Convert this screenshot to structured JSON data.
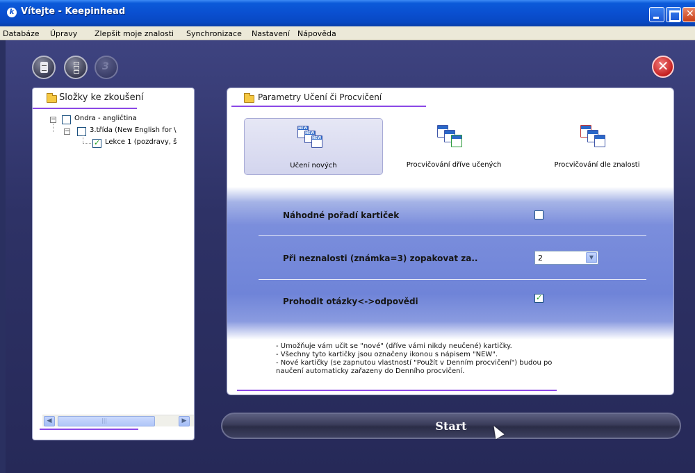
{
  "window": {
    "title": "Vítejte - Keepinhead",
    "app_icon_letter": "k"
  },
  "menu": [
    "Databáze",
    "Úpravy",
    "Zlepšit moje znalosti",
    "Synchronizace",
    "Nastavení",
    "Nápověda"
  ],
  "toolbar": {
    "buttons": [
      {
        "icon": "document-icon",
        "enabled": true
      },
      {
        "icon": "card-stack-icon",
        "enabled": true
      },
      {
        "icon": "number-3-icon",
        "label": "3",
        "enabled": false
      }
    ],
    "close_icon": "close-circle-icon",
    "close_symbol": "✕"
  },
  "left_panel": {
    "title": "Složky ke zkoušení",
    "tree": [
      {
        "label": "Ondra - angličtina",
        "checked": false,
        "level": 0,
        "expander": "−"
      },
      {
        "label": "3.třída (New English for \\",
        "checked": false,
        "level": 1,
        "expander": "−"
      },
      {
        "label": "Lekce 1 (pozdravy, š",
        "checked": true,
        "level": 2
      }
    ],
    "scroll_left": "◀",
    "scroll_right": "▶"
  },
  "main_panel": {
    "title": "Parametry Učení či Procvičení",
    "modes": [
      {
        "label": "Učení nových",
        "selected": true
      },
      {
        "label": "Procvičování dříve učených",
        "selected": false
      },
      {
        "label": "Procvičování dle znalosti",
        "selected": false
      }
    ],
    "options": {
      "random_order": {
        "label": "Náhodné pořadí kartiček",
        "checked": false
      },
      "repeat_after": {
        "label": "Při neznalosti (známka=3) zopakovat za..",
        "value": "2"
      },
      "swap": {
        "label": "Prohodit otázky<->odpovědi",
        "checked": true
      }
    },
    "help_lines": [
      "- Umožňuje vám učit se \"nové\" (dříve vámi nikdy neučené) kartičky.",
      "- Všechny tyto kartičky jsou označeny ikonou s nápisem \"NEW\".",
      "- Nové kartičky (se zapnutou vlastností \"Použít v Denním procvičení\") budou po",
      "naučení automaticky zařazeny do Denního procvičení."
    ]
  },
  "start_button": "Start",
  "colors": {
    "title_bar": "#0a4fd0",
    "app_bg": "#2e3266",
    "accent_underline": "#8b48e6",
    "option_band": "#6f84d8",
    "close_red": "#c51f1f"
  }
}
